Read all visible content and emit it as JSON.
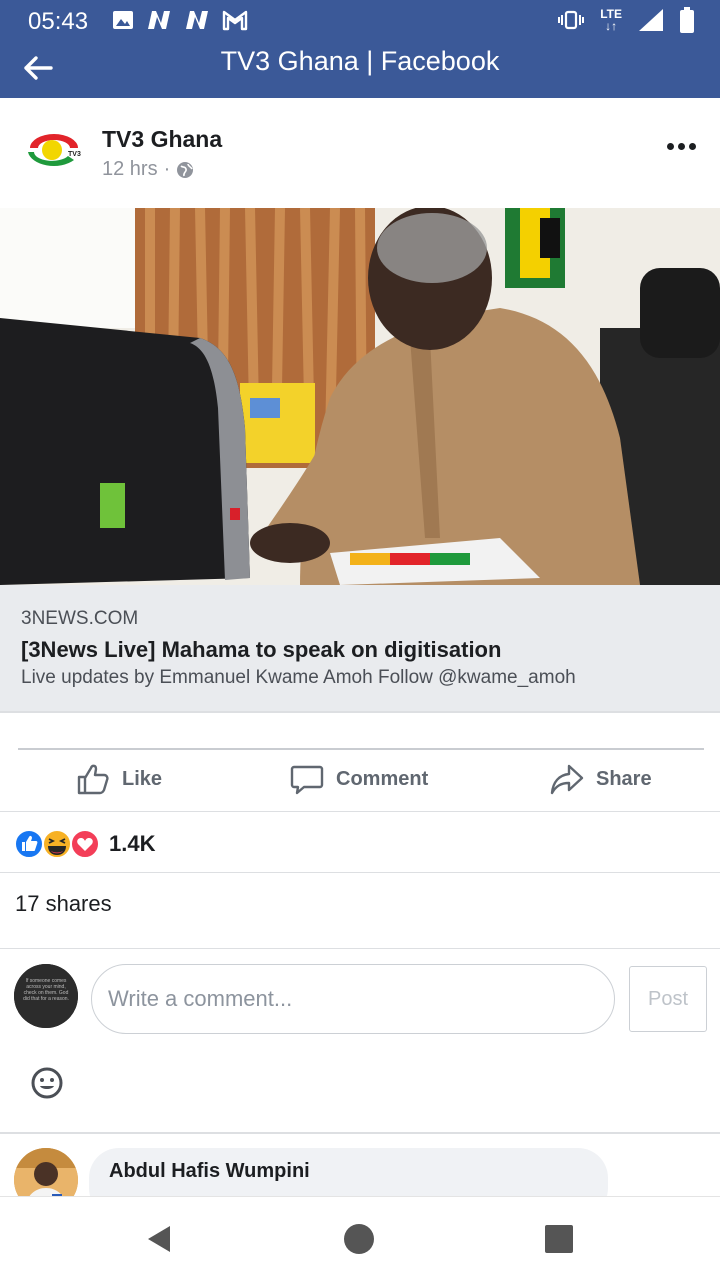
{
  "status_bar": {
    "time": "05:43",
    "network": "LTE",
    "icons": [
      "image-icon",
      "n-notification-icon",
      "n-notification-icon",
      "gmail-icon",
      "vibrate-icon",
      "lte-icon",
      "signal-icon",
      "battery-icon"
    ]
  },
  "header": {
    "title": "TV3 Ghana | Facebook",
    "back_icon": "arrow-left-icon",
    "bg_color": "#3b5998"
  },
  "post": {
    "page_name": "TV3 Ghana",
    "time_ago": "12 hrs",
    "separator": "·",
    "privacy_icon": "globe-icon",
    "logo_text": "TV3",
    "link": {
      "domain": "3NEWS.COM",
      "title": "[3News Live] Mahama to speak on digitisation",
      "description": "Live updates by Emmanuel Kwame Amoh Follow @kwame_amoh"
    },
    "actions": {
      "like": "Like",
      "comment": "Comment",
      "share": "Share"
    },
    "reactions": {
      "count": "1.4K",
      "types": [
        "like",
        "haha",
        "love"
      ]
    },
    "shares": "17 shares"
  },
  "composer": {
    "placeholder": "Write a comment...",
    "post_label": "Post",
    "avatar_text": "If someone comes across your mind, check on them. God did that for a reason."
  },
  "comments": [
    {
      "author": "Abdul Hafis Wumpini"
    }
  ],
  "nav": {
    "icons": [
      "back-triangle-icon",
      "home-circle-icon",
      "recents-square-icon"
    ]
  }
}
